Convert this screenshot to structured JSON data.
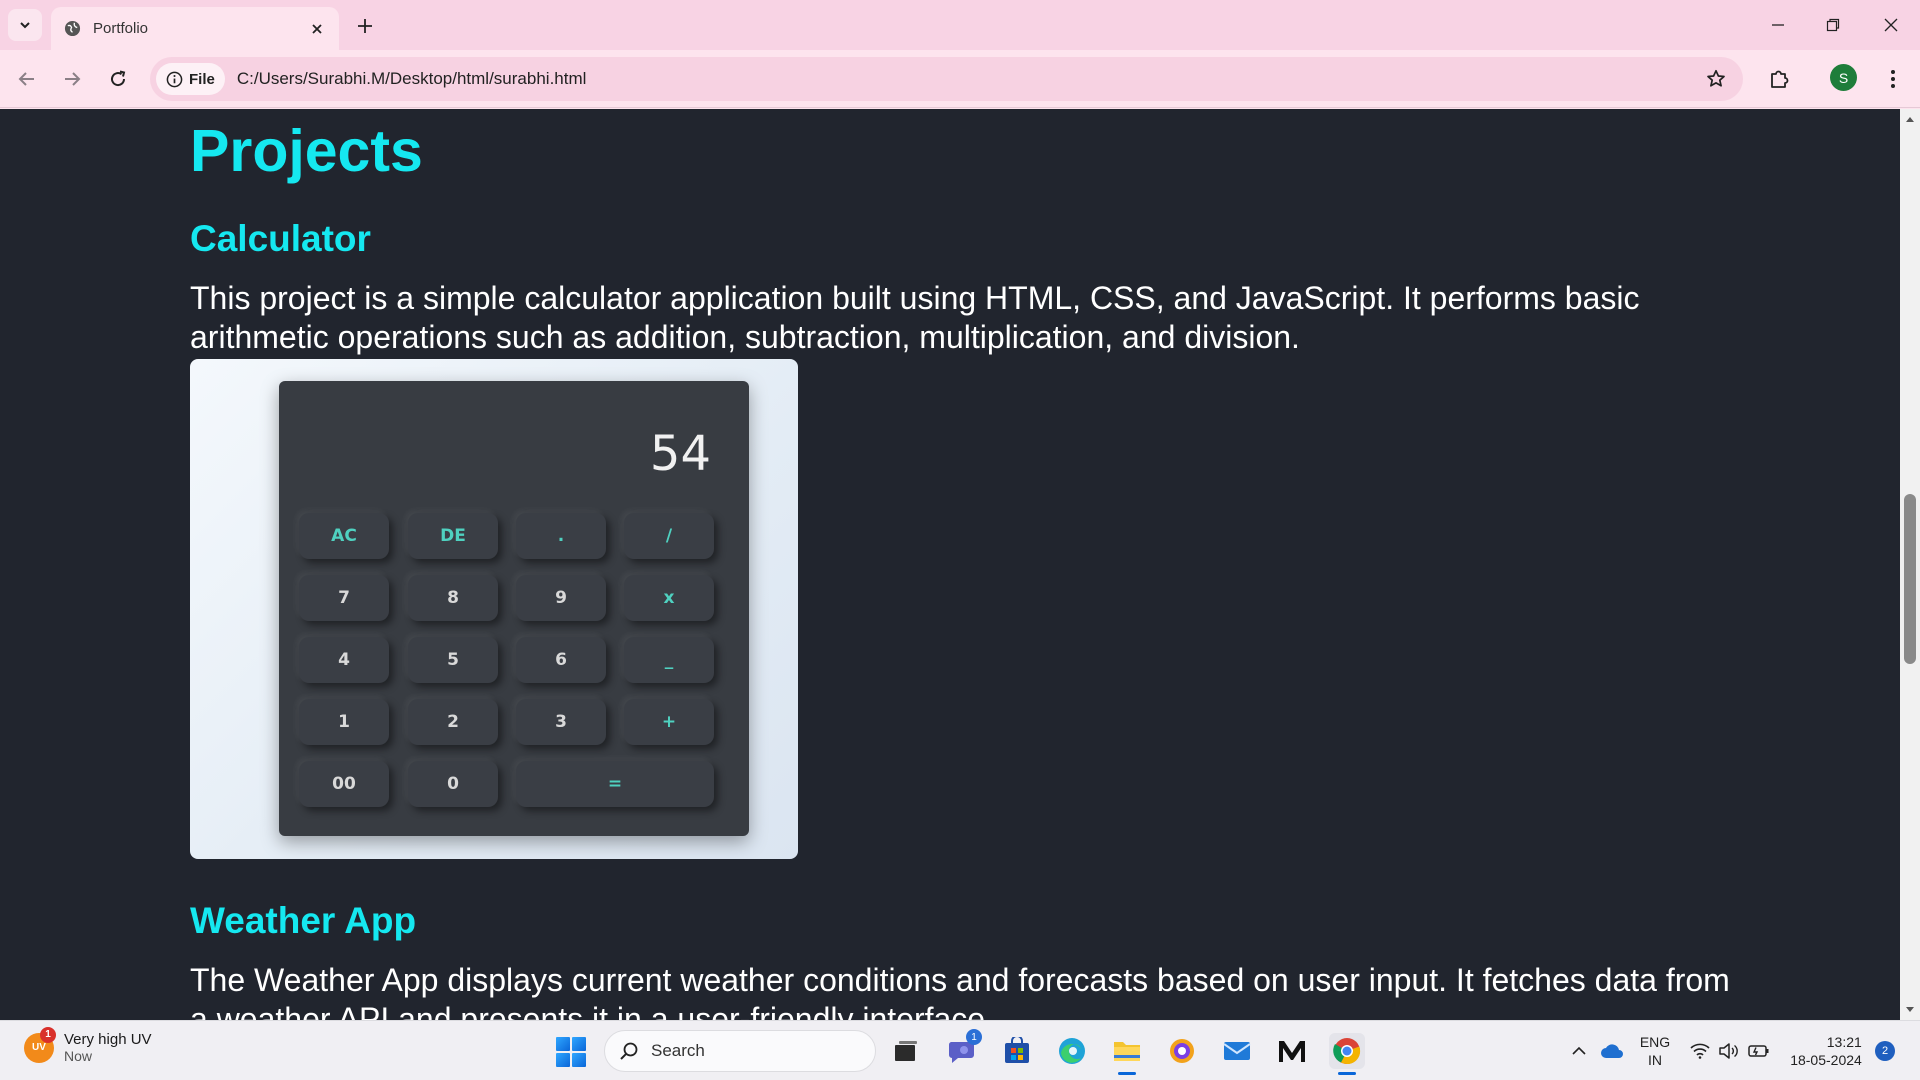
{
  "browser": {
    "tab_title": "Portfolio",
    "url": "C:/Users/Surabhi.M/Desktop/html/surabhi.html",
    "site_chip_label": "File",
    "profile_initial": "S"
  },
  "page": {
    "projects_heading": "Projects",
    "calculator": {
      "heading": "Calculator",
      "description": "This project is a simple calculator application built using HTML, CSS, and JavaScript. It performs basic arithmetic operations such as addition, subtraction, multiplication, and division.",
      "image": {
        "display_value": "54",
        "keys": [
          [
            "AC",
            "DE",
            ".",
            "/"
          ],
          [
            "7",
            "8",
            "9",
            "x"
          ],
          [
            "4",
            "5",
            "6",
            "_"
          ],
          [
            "1",
            "2",
            "3",
            "+"
          ],
          [
            "00",
            "0",
            "="
          ]
        ]
      }
    },
    "weather_app": {
      "heading": "Weather App",
      "description": "The Weather App displays current weather conditions and forecasts based on user input. It fetches data from a weather API and presents it in a user-friendly interface."
    }
  },
  "taskbar": {
    "weather_widget": {
      "title": "Very high UV",
      "subtitle": "Now",
      "icon_text": "UV",
      "badge": "1"
    },
    "search_label": "Search",
    "chat_badge": "1",
    "language": {
      "line1": "ENG",
      "line2": "IN"
    },
    "clock": {
      "time": "13:21",
      "date": "18-05-2024"
    },
    "notification_count": "2"
  },
  "colors": {
    "page_bg": "#21252e",
    "heading_accent": "#15e8f0",
    "browser_chrome": "#fde4ee",
    "tab_strip": "#f8d3e4"
  }
}
